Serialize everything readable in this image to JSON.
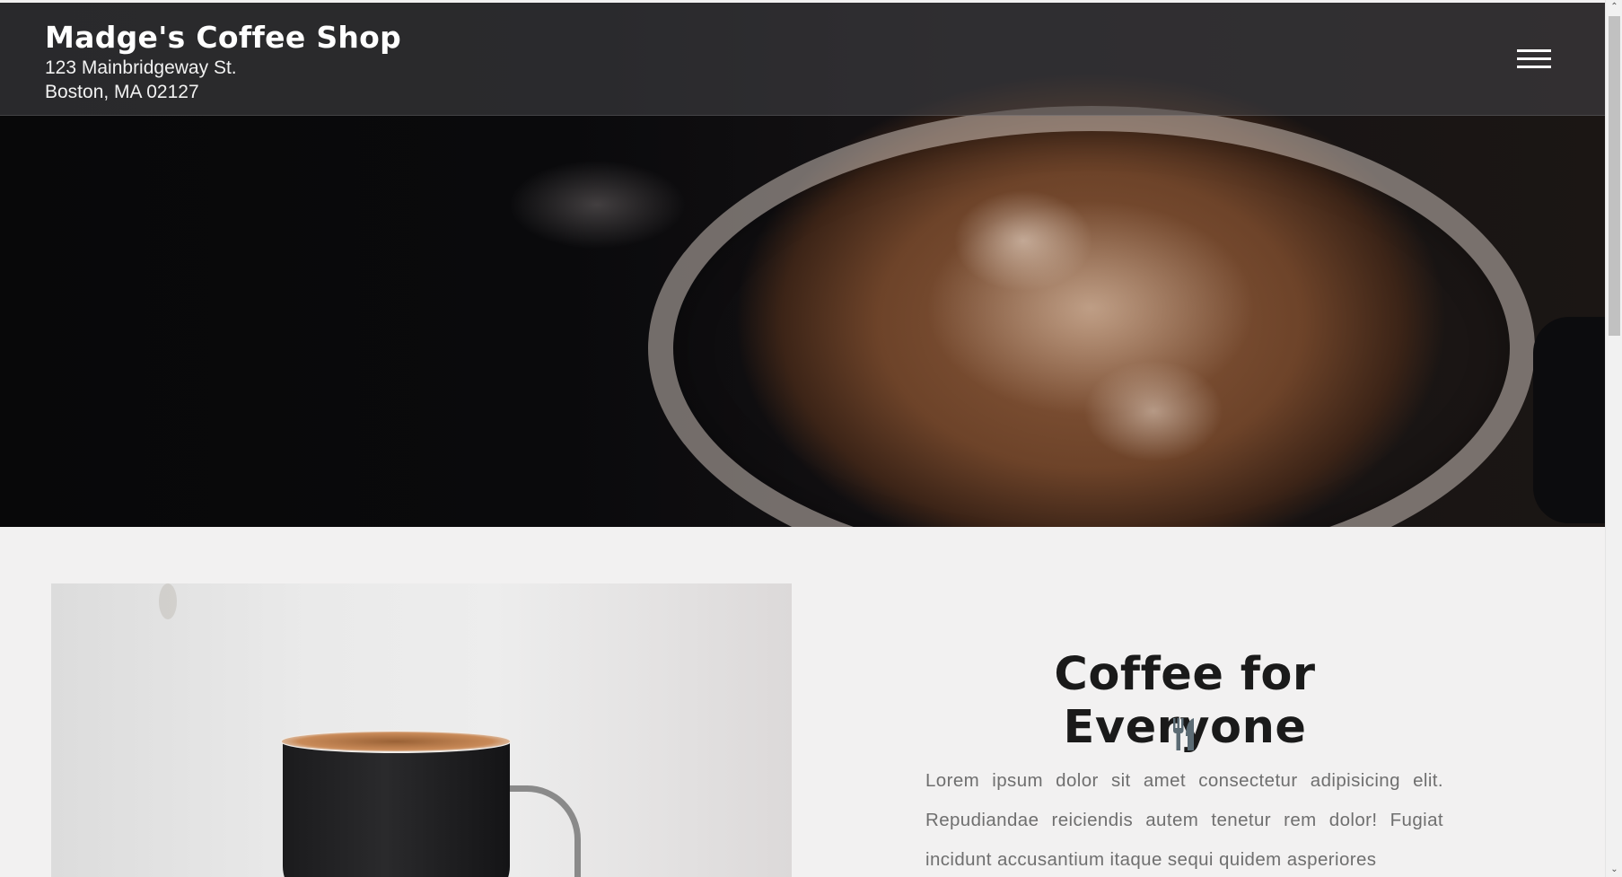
{
  "header": {
    "brand": "Madge's Coffee Shop",
    "address_line1": "123 Mainbridgeway St.",
    "address_line2": "Boston, MA 02127",
    "menu_icon": "hamburger-menu-icon"
  },
  "about": {
    "title": "Coffee for Everyone",
    "icon": "utensils-icon",
    "text": "Lorem ipsum dolor sit amet consectetur adipisicing elit. Repudiandae reiciendis autem tenetur rem dolor! Fugiat incidunt accusantium itaque sequi quidem asperiores"
  },
  "scrollbar": {
    "up_glyph": "⌃",
    "down_glyph": "⌄"
  },
  "colors": {
    "title_text": "#1a1a1a",
    "body_text": "#6f6f6f",
    "page_background": "#f2f1f1",
    "icon": "#5b6b74"
  }
}
